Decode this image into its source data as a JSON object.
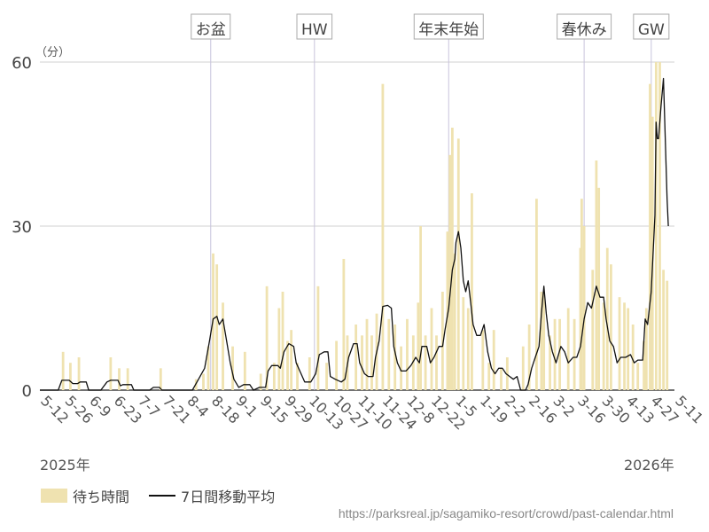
{
  "chart_data": {
    "type": "bar",
    "y_unit": "（分）",
    "ylim": [
      0,
      60
    ],
    "y_ticks": [
      0,
      30,
      60
    ],
    "year_labels": [
      "2025年",
      "2026年"
    ],
    "x_tick_labels": [
      "5-12",
      "5-26",
      "6-9",
      "6-23",
      "7-7",
      "7-21",
      "8-4",
      "8-18",
      "9-1",
      "9-15",
      "9-29",
      "10-13",
      "10-27",
      "11-10",
      "11-24",
      "12-8",
      "12-22",
      "1-5",
      "1-19",
      "2-2",
      "2-16",
      "3-2",
      "3-16",
      "3-30",
      "4-13",
      "4-27",
      "5-11"
    ],
    "events": [
      {
        "label": "お盆",
        "week": 14
      },
      {
        "label": "HW",
        "week": 22.5
      },
      {
        "label": "年末年始",
        "week": 33.5
      },
      {
        "label": "春休み",
        "week": 44.6
      },
      {
        "label": "GW",
        "week": 50.1
      }
    ],
    "legend": {
      "bar": "待ち時間",
      "line": "7日間移動平均"
    },
    "colors": {
      "bar": "#efe2b0",
      "line": "#111111",
      "event_line": "#c8c4dc",
      "grid": "#d0d0d0"
    },
    "source": "https://parksreal.jp/sagamiko-resort/crowd/past-calendar.html",
    "bars": [
      [
        1.9,
        7
      ],
      [
        2.5,
        5
      ],
      [
        3.2,
        6
      ],
      [
        5.8,
        6
      ],
      [
        6.5,
        4
      ],
      [
        7.2,
        4
      ],
      [
        9.9,
        4
      ],
      [
        12.8,
        2
      ],
      [
        13.4,
        3
      ],
      [
        13.8,
        8
      ],
      [
        14.2,
        25
      ],
      [
        14.5,
        23
      ],
      [
        15,
        16
      ],
      [
        15.8,
        8
      ],
      [
        16.8,
        7
      ],
      [
        18.1,
        3
      ],
      [
        18.6,
        19
      ],
      [
        19.2,
        5
      ],
      [
        19.6,
        15
      ],
      [
        19.9,
        18
      ],
      [
        20.3,
        9
      ],
      [
        20.6,
        11
      ],
      [
        21.1,
        5
      ],
      [
        22.1,
        6
      ],
      [
        22.8,
        19
      ],
      [
        23.5,
        5
      ],
      [
        24.3,
        9
      ],
      [
        24.9,
        24
      ],
      [
        25.2,
        10
      ],
      [
        25.9,
        12
      ],
      [
        26.4,
        10
      ],
      [
        26.8,
        13
      ],
      [
        27.2,
        10
      ],
      [
        27.6,
        14
      ],
      [
        28.1,
        56
      ],
      [
        28.6,
        13
      ],
      [
        29.1,
        12
      ],
      [
        29.6,
        8
      ],
      [
        30.1,
        13
      ],
      [
        30.6,
        10
      ],
      [
        31,
        16
      ],
      [
        31.2,
        30
      ],
      [
        31.6,
        10
      ],
      [
        32.1,
        15
      ],
      [
        32.5,
        10
      ],
      [
        33,
        18
      ],
      [
        33.4,
        29
      ],
      [
        33.6,
        43
      ],
      [
        33.8,
        48
      ],
      [
        34,
        25
      ],
      [
        34.3,
        46
      ],
      [
        34.7,
        17
      ],
      [
        35.1,
        15
      ],
      [
        35.4,
        36
      ],
      [
        36.3,
        11
      ],
      [
        36.8,
        5
      ],
      [
        37.2,
        11
      ],
      [
        37.8,
        4
      ],
      [
        38.3,
        6
      ],
      [
        39.6,
        8
      ],
      [
        40.1,
        12
      ],
      [
        40.7,
        35
      ],
      [
        41.1,
        18
      ],
      [
        41.3,
        18
      ],
      [
        41.8,
        10
      ],
      [
        42.2,
        13
      ],
      [
        42.6,
        13
      ],
      [
        43.3,
        15
      ],
      [
        43.8,
        13
      ],
      [
        44.3,
        26
      ],
      [
        44.4,
        35
      ],
      [
        44.6,
        30
      ],
      [
        45.3,
        22
      ],
      [
        45.6,
        42
      ],
      [
        45.8,
        37
      ],
      [
        46.2,
        16
      ],
      [
        46.5,
        26
      ],
      [
        46.8,
        23
      ],
      [
        47.5,
        17
      ],
      [
        47.9,
        16
      ],
      [
        48.2,
        15
      ],
      [
        48.6,
        12
      ],
      [
        49,
        5
      ],
      [
        49.5,
        9
      ],
      [
        49.7,
        15
      ],
      [
        50,
        56
      ],
      [
        50.2,
        50
      ],
      [
        50.5,
        60
      ],
      [
        50.8,
        60
      ],
      [
        51.1,
        22
      ],
      [
        51.4,
        20
      ]
    ],
    "moving_avg": [
      [
        0,
        0
      ],
      [
        1.5,
        0
      ],
      [
        1.8,
        1.8
      ],
      [
        2.4,
        1.8
      ],
      [
        2.7,
        1.2
      ],
      [
        3.1,
        1.2
      ],
      [
        3.3,
        1.5
      ],
      [
        3.8,
        1.5
      ],
      [
        4,
        0
      ],
      [
        5,
        0
      ],
      [
        5.5,
        1.5
      ],
      [
        5.8,
        1.8
      ],
      [
        6.4,
        1.8
      ],
      [
        6.6,
        0.8
      ],
      [
        6.8,
        1
      ],
      [
        7.5,
        1
      ],
      [
        7.7,
        0
      ],
      [
        9,
        0
      ],
      [
        9.3,
        0.5
      ],
      [
        9.8,
        0.5
      ],
      [
        10,
        0
      ],
      [
        12.5,
        0
      ],
      [
        13,
        2
      ],
      [
        13.5,
        4
      ],
      [
        13.9,
        9
      ],
      [
        14.2,
        13
      ],
      [
        14.5,
        13.5
      ],
      [
        14.7,
        12
      ],
      [
        15,
        13
      ],
      [
        15.3,
        9
      ],
      [
        15.6,
        5
      ],
      [
        15.9,
        2
      ],
      [
        16.3,
        0.5
      ],
      [
        16.7,
        1
      ],
      [
        17.2,
        1
      ],
      [
        17.5,
        0
      ],
      [
        18,
        0.5
      ],
      [
        18.5,
        0.5
      ],
      [
        18.7,
        3.5
      ],
      [
        19,
        4.5
      ],
      [
        19.5,
        4.5
      ],
      [
        19.7,
        4
      ],
      [
        20,
        7
      ],
      [
        20.4,
        8.5
      ],
      [
        20.8,
        8
      ],
      [
        21,
        5
      ],
      [
        21.4,
        3
      ],
      [
        21.7,
        1.5
      ],
      [
        22.2,
        1.5
      ],
      [
        22.6,
        3
      ],
      [
        22.9,
        6.5
      ],
      [
        23.3,
        7
      ],
      [
        23.6,
        7
      ],
      [
        23.8,
        2.5
      ],
      [
        24.2,
        2
      ],
      [
        24.7,
        1.5
      ],
      [
        25,
        2
      ],
      [
        25.3,
        6
      ],
      [
        25.7,
        8.5
      ],
      [
        26,
        8.5
      ],
      [
        26.2,
        5
      ],
      [
        26.6,
        3
      ],
      [
        26.9,
        2.5
      ],
      [
        27.3,
        2.5
      ],
      [
        27.5,
        6
      ],
      [
        27.8,
        9
      ],
      [
        28.1,
        15.3
      ],
      [
        28.5,
        15.5
      ],
      [
        28.8,
        15
      ],
      [
        29,
        8
      ],
      [
        29.3,
        5
      ],
      [
        29.6,
        3.5
      ],
      [
        30,
        3.5
      ],
      [
        30.4,
        4.5
      ],
      [
        30.8,
        6
      ],
      [
        31.1,
        5
      ],
      [
        31.3,
        8
      ],
      [
        31.7,
        8
      ],
      [
        32,
        5
      ],
      [
        32.3,
        6
      ],
      [
        32.7,
        8
      ],
      [
        33,
        8
      ],
      [
        33.2,
        11
      ],
      [
        33.5,
        15
      ],
      [
        33.8,
        22
      ],
      [
        34,
        24
      ],
      [
        34.1,
        27
      ],
      [
        34.3,
        29
      ],
      [
        34.5,
        26
      ],
      [
        34.7,
        20
      ],
      [
        34.9,
        18
      ],
      [
        35.1,
        20
      ],
      [
        35.3,
        16
      ],
      [
        35.5,
        12
      ],
      [
        35.8,
        10
      ],
      [
        36.1,
        10
      ],
      [
        36.4,
        12
      ],
      [
        36.7,
        7
      ],
      [
        37,
        4
      ],
      [
        37.3,
        3
      ],
      [
        37.6,
        4
      ],
      [
        37.9,
        4
      ],
      [
        38.2,
        3
      ],
      [
        38.5,
        2.5
      ],
      [
        38.8,
        2
      ],
      [
        39.1,
        2.5
      ],
      [
        39.4,
        0
      ],
      [
        39.8,
        0
      ],
      [
        40,
        1
      ],
      [
        40.3,
        4
      ],
      [
        40.6,
        6
      ],
      [
        40.9,
        8
      ],
      [
        41.1,
        14
      ],
      [
        41.3,
        19
      ],
      [
        41.5,
        14
      ],
      [
        41.7,
        10
      ],
      [
        42,
        7
      ],
      [
        42.3,
        5
      ],
      [
        42.7,
        8
      ],
      [
        43,
        7
      ],
      [
        43.3,
        5
      ],
      [
        43.7,
        6
      ],
      [
        44,
        6
      ],
      [
        44.3,
        8
      ],
      [
        44.6,
        13
      ],
      [
        44.9,
        16
      ],
      [
        45.2,
        15
      ],
      [
        45.6,
        19
      ],
      [
        45.9,
        17
      ],
      [
        46.2,
        17
      ],
      [
        46.4,
        13
      ],
      [
        46.7,
        9
      ],
      [
        47,
        8
      ],
      [
        47.3,
        5
      ],
      [
        47.6,
        6
      ],
      [
        48,
        6
      ],
      [
        48.4,
        6.5
      ],
      [
        48.7,
        5
      ],
      [
        49,
        5.5
      ],
      [
        49.4,
        5.5
      ],
      [
        49.6,
        13
      ],
      [
        49.8,
        12
      ],
      [
        50.1,
        18
      ],
      [
        50.4,
        32
      ],
      [
        50.5,
        49
      ],
      [
        50.6,
        46
      ],
      [
        50.7,
        46
      ],
      [
        50.9,
        52
      ],
      [
        51.1,
        57
      ],
      [
        51.3,
        42
      ],
      [
        51.4,
        35
      ],
      [
        51.5,
        30
      ]
    ]
  }
}
